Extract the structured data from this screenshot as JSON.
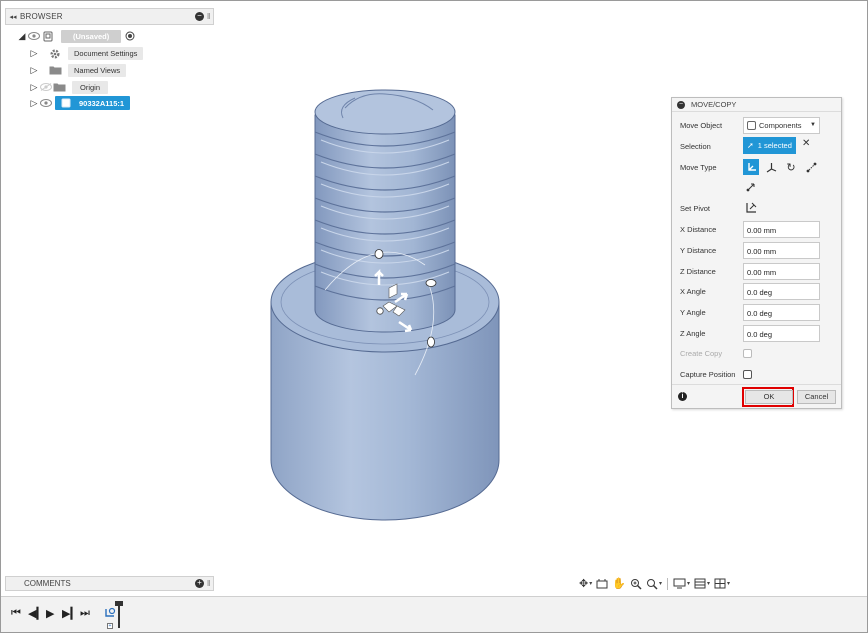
{
  "browser": {
    "title": "BROWSER",
    "root_label": "(Unsaved)",
    "items": [
      {
        "label": "Document Settings",
        "icon": "gear-icon"
      },
      {
        "label": "Named Views",
        "icon": "folder-icon"
      },
      {
        "label": "Origin",
        "icon": "folder-icon"
      },
      {
        "label": "90332A115:1",
        "icon": "component-icon"
      }
    ]
  },
  "comments": {
    "title": "COMMENTS"
  },
  "dialog": {
    "title": "MOVE/COPY",
    "move_object_label": "Move Object",
    "move_object_value": "Components",
    "selection_label": "Selection",
    "selection_value": "1 selected",
    "move_type_label": "Move Type",
    "move_types": [
      "free-move-icon",
      "translate-icon",
      "rotate-icon",
      "point-to-point-icon",
      "point-to-position-icon"
    ],
    "set_pivot_label": "Set Pivot",
    "x_distance_label": "X Distance",
    "x_distance_value": "0.00 mm",
    "y_distance_label": "Y Distance",
    "y_distance_value": "0.00 mm",
    "z_distance_label": "Z Distance",
    "z_distance_value": "0.00 mm",
    "x_angle_label": "X Angle",
    "x_angle_value": "0.0 deg",
    "y_angle_label": "Y Angle",
    "y_angle_value": "0.0 deg",
    "z_angle_label": "Z Angle",
    "z_angle_value": "0.0 deg",
    "create_copy_label": "Create Copy",
    "capture_position_label": "Capture Position",
    "ok_label": "OK",
    "cancel_label": "Cancel"
  },
  "colors": {
    "accent": "#2196d6",
    "highlight": "#e00000",
    "model": "#a9bdd9"
  },
  "nav_icons": [
    "orbit-icon",
    "look-at-icon",
    "pan-icon",
    "zoom-window-icon",
    "zoom-icon",
    "display-settings-icon",
    "grid-icon",
    "viewports-icon"
  ],
  "timeline_icons": [
    "go-to-start-icon",
    "step-back-icon",
    "play-icon",
    "step-forward-icon",
    "go-to-end-icon"
  ]
}
